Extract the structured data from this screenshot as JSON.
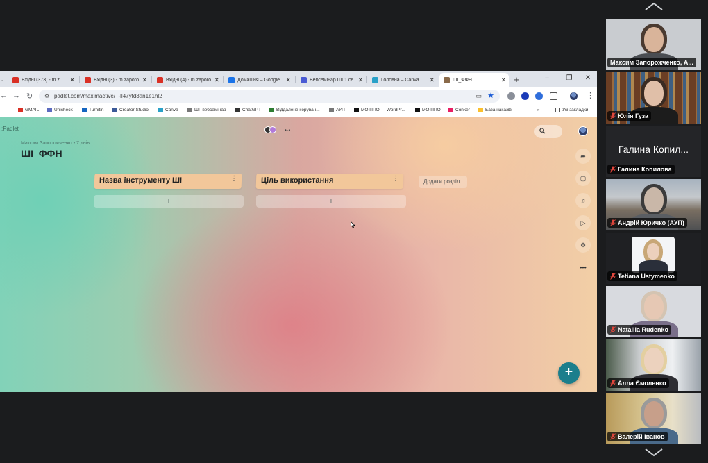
{
  "browser": {
    "tabs": [
      {
        "label": "Вхідні (373) - m.zaporo",
        "icon": "gmail-icon",
        "color": "#d93025"
      },
      {
        "label": "Вхідні (3) - m.zaporo",
        "icon": "gmail-icon",
        "color": "#d93025"
      },
      {
        "label": "Вхідні (4) - m.zaporo",
        "icon": "gmail-icon",
        "color": "#d93025"
      },
      {
        "label": "Домашня – Google",
        "icon": "google-drive-icon",
        "color": "#1a73e8"
      },
      {
        "label": "Вебсемінар ШІ 1 се",
        "icon": "meet-icon",
        "color": "#4a5bd4"
      },
      {
        "label": "Головна – Canva",
        "icon": "canva-icon",
        "color": "#2aa1c8"
      },
      {
        "label": "ШІ_ФФН",
        "icon": "padlet-icon",
        "color": "#8a6a4a"
      }
    ],
    "url": "padlet.com/maximactive/_-ll47yfd3an1e1hl2",
    "bookmarks": [
      {
        "label": "GMAIL",
        "color": "#d93025"
      },
      {
        "label": "Unicheck",
        "color": "#5c6bc0"
      },
      {
        "label": "Turnitin",
        "color": "#1565c0"
      },
      {
        "label": "Creator Studio",
        "color": "#3b5998"
      },
      {
        "label": "Canva",
        "color": "#2aa1c8"
      },
      {
        "label": "ШІ_вебсемінар",
        "color": "#777777"
      },
      {
        "label": "ChatGPT",
        "color": "#333333"
      },
      {
        "label": "Віддалене керуван...",
        "color": "#2e7d32"
      },
      {
        "label": "АУП",
        "color": "#777777"
      },
      {
        "label": "МОІППО — WordPr...",
        "color": "#111111"
      },
      {
        "label": "МОІППО",
        "color": "#111111"
      },
      {
        "label": "Conker",
        "color": "#e91e63"
      },
      {
        "label": "База наказів",
        "color": "#fbc02d"
      }
    ],
    "bookmarks_overflow": "»",
    "all_bookmarks": "Усі закладки"
  },
  "board": {
    "logo": ":Padlet",
    "author_line": "Максим Запорожченко • 7 днів",
    "title": "ШІ_ФФН",
    "sections": [
      {
        "title": "Назва інструменту ШІ",
        "menu": "⋮",
        "add": "+"
      },
      {
        "title": "Ціль використання",
        "menu": "⋮",
        "add": "+"
      }
    ],
    "add_section_label": "Додати розділ",
    "fab": "+",
    "search_icon": "search-icon",
    "side_tools": [
      "share-icon",
      "slideshow-icon",
      "bell-icon",
      "play-icon",
      "settings-icon",
      "more-icon"
    ]
  },
  "meeting": {
    "participants": [
      {
        "name": "Максим Запорожченко, А...",
        "active": true,
        "muted": false,
        "video": true,
        "bg": "#c9ccd0",
        "skin": "#d9b49a",
        "hair": "#4a3a30",
        "shirt": "#4a4d52"
      },
      {
        "name": "Юлія Гуза",
        "active": false,
        "muted": true,
        "video": true,
        "bg": "#8a5a3a",
        "skin": "#e0bfa8",
        "hair": "#3a2b22",
        "shirt": "#1c1c1c"
      },
      {
        "name": "Галина Копилова",
        "active": false,
        "muted": true,
        "video": false,
        "big_name": "Галина Копил..."
      },
      {
        "name": "Андрій Юричко (АУП)",
        "active": false,
        "muted": true,
        "video": true,
        "bg": "#9aa0a6",
        "skin": "#c9b7a8",
        "hair": "#3b3b3b",
        "shirt": "#5a5e63"
      },
      {
        "name": "Tetiana Ustymenko",
        "active": false,
        "muted": true,
        "video": false,
        "photo": true,
        "skin": "#ecd0bc",
        "hair": "#c8a777",
        "shirt": "#2a2f3a"
      },
      {
        "name": "Nataliia Rudenko",
        "active": false,
        "muted": true,
        "video": true,
        "bg": "#d8dadf",
        "skin": "#e6c8b4",
        "hair": "#d4c4b2",
        "shirt": "#7a6f8a"
      },
      {
        "name": "Алла Ємоленко",
        "active": false,
        "muted": true,
        "video": true,
        "bg": "#b8bcc0",
        "skin": "#ecd2be",
        "hair": "#e3cfa0",
        "shirt": "#2e2e33"
      },
      {
        "name": "Валерій Іванов",
        "active": false,
        "muted": true,
        "video": true,
        "bg": "#cbb483",
        "skin": "#c79f8a",
        "hair": "#9a9a9a",
        "shirt": "#4a6a8a"
      }
    ]
  }
}
